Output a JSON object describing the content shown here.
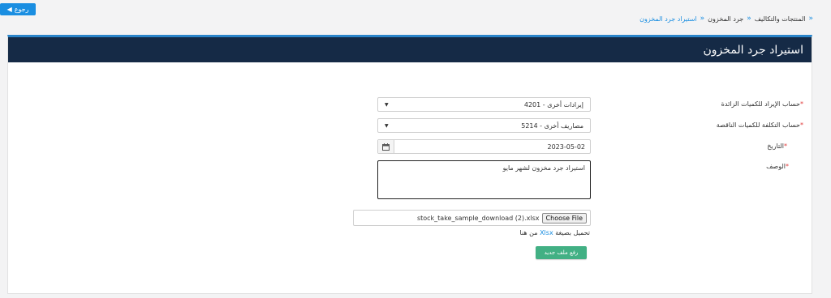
{
  "back_button": {
    "label": "رجوع",
    "arrow_icon": "arrow-left-icon"
  },
  "breadcrumb": {
    "items": [
      {
        "label": "المنتجات والتكاليف"
      },
      {
        "label": "جرد المخزون"
      },
      {
        "label": "استيراد جرد المخزون"
      }
    ]
  },
  "panel": {
    "title": "استيراد جرد المخزون"
  },
  "form": {
    "income_account": {
      "label": "حساب الإيراد للكميات الزائدة",
      "value": "4201 - إيرادات أخرى"
    },
    "cost_account": {
      "label": "حساب التكلفة للكميات الناقصة",
      "value": "5214 - مصاريف أخرى"
    },
    "date": {
      "label": "التاريخ",
      "value": "2023-05-02"
    },
    "description": {
      "label": "الوصف",
      "value": "استيراد جرد مخزون لشهر مايو"
    },
    "required_mark": "*",
    "file": {
      "button": "Choose File",
      "filename": "stock_take_sample_download (2).xlsx"
    },
    "hint": {
      "prefix": "تحميل بصيغة",
      "link": "Xlsx",
      "suffix": "من هنا"
    },
    "upload_button": "رفع ملف جديد"
  },
  "colors": {
    "header": "#152a46",
    "accent": "#1a8ee1",
    "upload": "#42b084",
    "required": "#e03a3a"
  }
}
